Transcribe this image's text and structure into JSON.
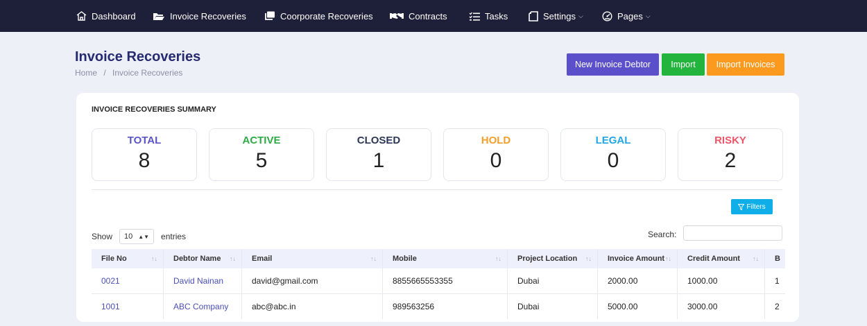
{
  "nav": {
    "items": [
      {
        "label": "Dashboard",
        "icon": "home-icon"
      },
      {
        "label": "Invoice Recoveries",
        "icon": "folder-icon"
      },
      {
        "label": "Coorporate Recoveries",
        "icon": "copy-icon"
      },
      {
        "label": "Contracts",
        "icon": "handshake-icon"
      },
      {
        "label": "Tasks",
        "icon": "list-check-icon"
      },
      {
        "label": "Settings",
        "icon": "doc-icon"
      },
      {
        "label": "Pages",
        "icon": "gauge-icon"
      }
    ]
  },
  "header": {
    "title": "Invoice Recoveries",
    "breadcrumb": [
      "Home",
      "/",
      "Invoice Recoveries"
    ]
  },
  "actions": {
    "new_debtor": "New Invoice Debtor",
    "import": "Import",
    "import_invoices": "Import Invoices"
  },
  "summary": {
    "title": "INVOICE RECOVERIES SUMMARY",
    "stats": [
      {
        "label": "TOTAL",
        "value": "8",
        "color": "#5a54c8"
      },
      {
        "label": "ACTIVE",
        "value": "5",
        "color": "#2eaa46"
      },
      {
        "label": "CLOSED",
        "value": "1",
        "color": "#2c3757"
      },
      {
        "label": "HOLD",
        "value": "0",
        "color": "#f59e2b"
      },
      {
        "label": "LEGAL",
        "value": "0",
        "color": "#21a6e8"
      },
      {
        "label": "RISKY",
        "value": "2",
        "color": "#ee5467"
      }
    ]
  },
  "filters_label": "Filters",
  "table": {
    "show_label": "Show",
    "page_length": "10",
    "entries_label": "entries",
    "search_label": "Search:",
    "columns": [
      "File No",
      "Debtor Name",
      "Email",
      "Mobile",
      "Project Location",
      "Invoice Amount",
      "Credit Amount",
      "B"
    ],
    "rows": [
      [
        "0021",
        "David Nainan",
        "david@gmail.com",
        "8855665553355",
        "Dubai",
        "2000.00",
        "1000.00",
        "1"
      ],
      [
        "1001",
        "ABC Company",
        "abc@abc.in",
        "989563256",
        "Dubai",
        "5000.00",
        "3000.00",
        "2"
      ]
    ]
  },
  "colors": {
    "nav_bg": "#1e1f38",
    "title": "#262a6e",
    "btn_purple": "#5b50c9",
    "btn_green": "#22b43c",
    "btn_orange": "#fb9a1f",
    "btn_filters": "#0faee8"
  }
}
